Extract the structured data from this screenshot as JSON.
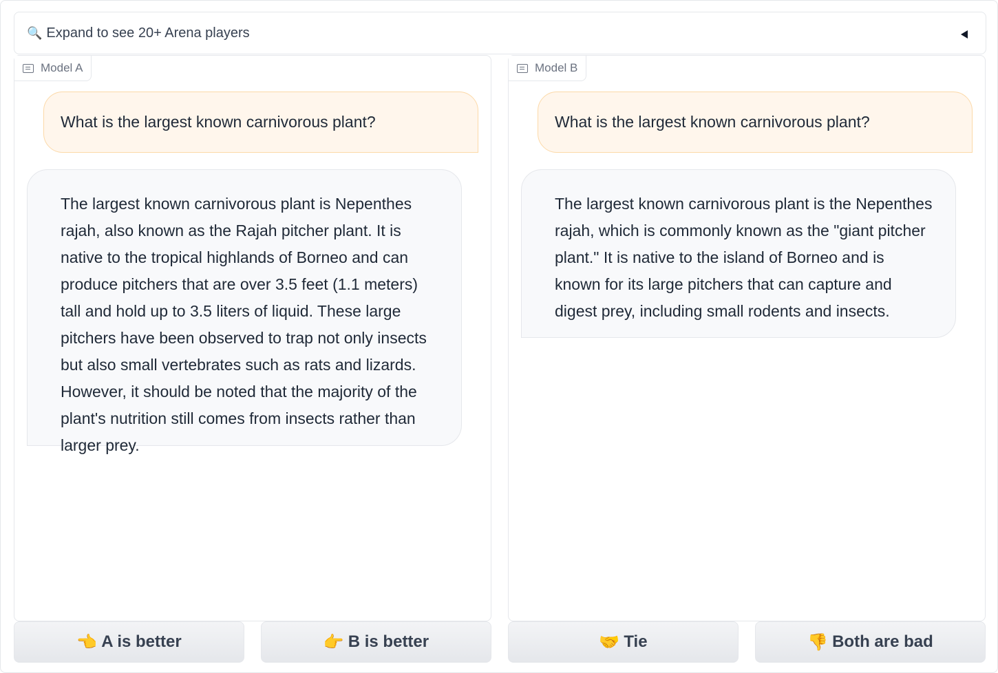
{
  "accordion": {
    "icon": "🔍",
    "label": "Expand to see 20+ Arena players"
  },
  "panels": {
    "a": {
      "label": "Model A",
      "user_message": "What is the largest known carnivorous plant?",
      "bot_message": "The largest known carnivorous plant is Nepenthes rajah, also known as the Rajah pitcher plant. It is native to the tropical highlands of Borneo and can produce pitchers that are over 3.5 feet (1.1 meters) tall and hold up to 3.5 liters of liquid. These large pitchers have been observed to trap not only insects but also small vertebrates such as rats and lizards. However, it should be noted that the majority of the plant's nutrition still comes from insects rather than larger prey."
    },
    "b": {
      "label": "Model B",
      "user_message": "What is the largest known carnivorous plant?",
      "bot_message": "The largest known carnivorous plant is the Nepenthes rajah, which is commonly known as the \"giant pitcher plant.\" It is native to the island of Borneo and is known for its large pitchers that can capture and digest prey, including small rodents and insects."
    }
  },
  "votes": [
    {
      "emoji": "👈",
      "label": "A is better"
    },
    {
      "emoji": "👉",
      "label": "B is better"
    },
    {
      "emoji": "🤝",
      "label": "Tie"
    },
    {
      "emoji": "👎",
      "label": "Both are bad"
    }
  ],
  "colors": {
    "user_bubble_bg": "#fff6ec",
    "user_bubble_border": "#fcd9a8",
    "bot_bubble_bg": "#f8f9fb",
    "border": "#e5e7eb"
  }
}
